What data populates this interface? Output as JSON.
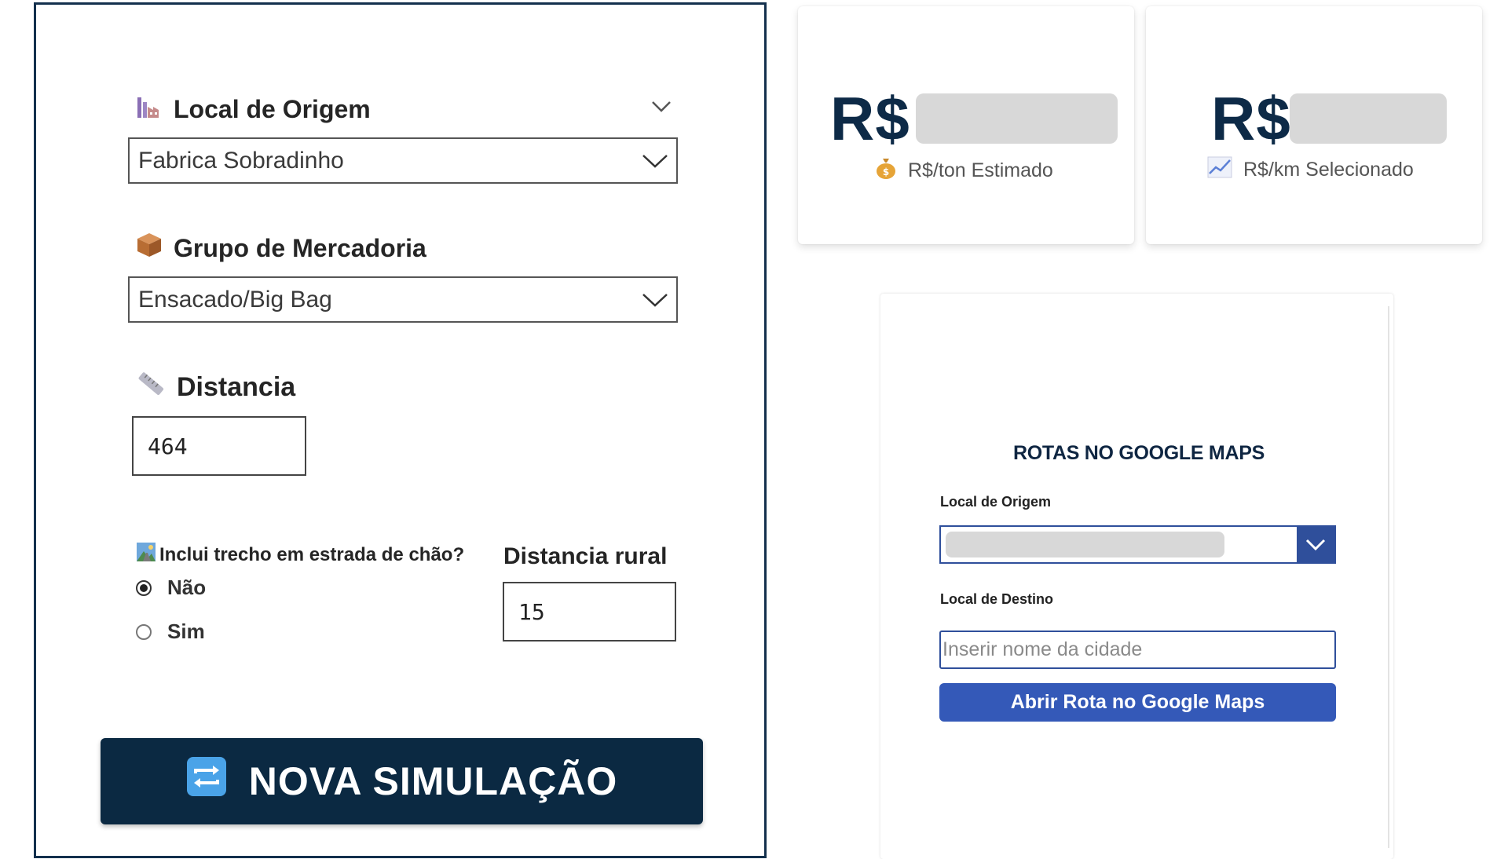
{
  "simulator": {
    "origin": {
      "label": "Local de Origem",
      "value": "Fabrica Sobradinho"
    },
    "goods_group": {
      "label": "Grupo de Mercadoria",
      "value": "Ensacado/Big Bag"
    },
    "distance": {
      "label": "Distancia",
      "value": "464"
    },
    "dirt_road": {
      "question": "Inclui trecho em estrada de chão?",
      "options": [
        "Não",
        "Sim"
      ],
      "selected": "Não"
    },
    "rural_distance": {
      "label": "Distancia rural",
      "value": "15"
    },
    "new_simulation_button": "NOVA SIMULAÇÃO"
  },
  "kpis": {
    "estimated": {
      "currency": "R$",
      "caption": "R$/ton Estimado"
    },
    "selected": {
      "currency": "R$",
      "caption": "R$/km Selecionado"
    }
  },
  "maps": {
    "title": "ROTAS NO GOOGLE MAPS",
    "origin_label": "Local de Origem",
    "destination_label": "Local de Destino",
    "destination_placeholder": "Inserir nome da cidade",
    "open_button": "Abrir Rota no Google Maps"
  },
  "colors": {
    "navy": "#0b2942",
    "accent_blue": "#3459b8",
    "border_blue": "#2f4f9b",
    "panel_border": "#13304d"
  },
  "icons": {
    "origin": "factory-icon",
    "goods": "package-icon",
    "distance": "ruler-icon",
    "dirt_road": "road-image-icon",
    "refresh": "refresh-icon",
    "estimated": "money-bag-icon",
    "selected": "chart-increasing-icon"
  }
}
